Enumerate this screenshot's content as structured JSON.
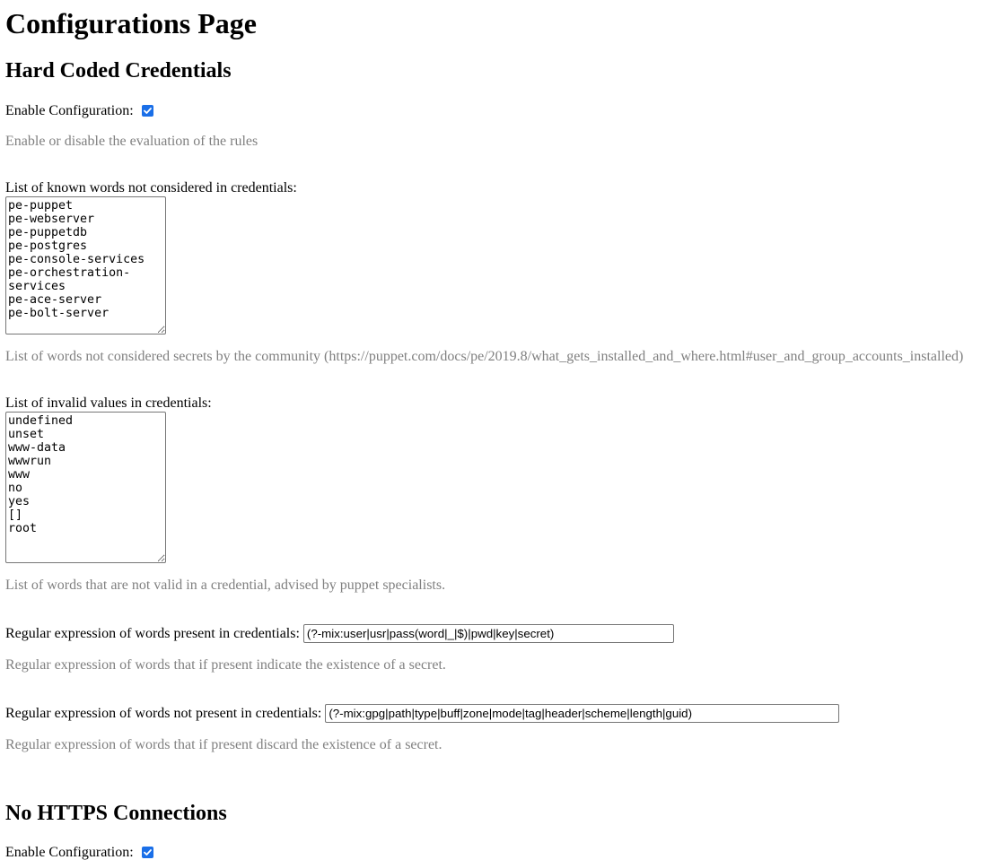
{
  "page_title": "Configurations Page",
  "sections": [
    {
      "heading": "Hard Coded Credentials",
      "enable_label": "Enable Configuration:",
      "enable_checked": true,
      "enable_desc": "Enable or disable the evaluation of the rules",
      "known_words_label": "List of known words not considered in credentials:",
      "known_words_value": "pe-puppet\npe-webserver\npe-puppetdb\npe-postgres\npe-console-services\npe-orchestration-services\npe-ace-server\npe-bolt-server",
      "known_words_desc": "List of words not considered secrets by the community (https://puppet.com/docs/pe/2019.8/what_gets_installed_and_where.html#user_and_group_accounts_installed)",
      "invalid_values_label": "List of invalid values in credentials:",
      "invalid_values_value": "undefined\nunset\nwww-data\nwwwrun\nwww\nno\nyes\n[]\nroot",
      "invalid_values_desc": "List of words that are not valid in a credential, advised by puppet specialists.",
      "regex_present_label": "Regular expression of words present in credentials:",
      "regex_present_value": "(?-mix:user|usr|pass(word|_|$)|pwd|key|secret)",
      "regex_present_desc": "Regular expression of words that if present indicate the existence of a secret.",
      "regex_absent_label": "Regular expression of words not present in credentials:",
      "regex_absent_value": "(?-mix:gpg|path|type|buff|zone|mode|tag|header|scheme|length|guid)",
      "regex_absent_desc": "Regular expression of words that if present discard the existence of a secret."
    },
    {
      "heading": "No HTTPS Connections",
      "enable_label": "Enable Configuration:",
      "enable_checked": true
    }
  ],
  "colors": {
    "accent": "#1a6fe8",
    "description": "#808080"
  }
}
